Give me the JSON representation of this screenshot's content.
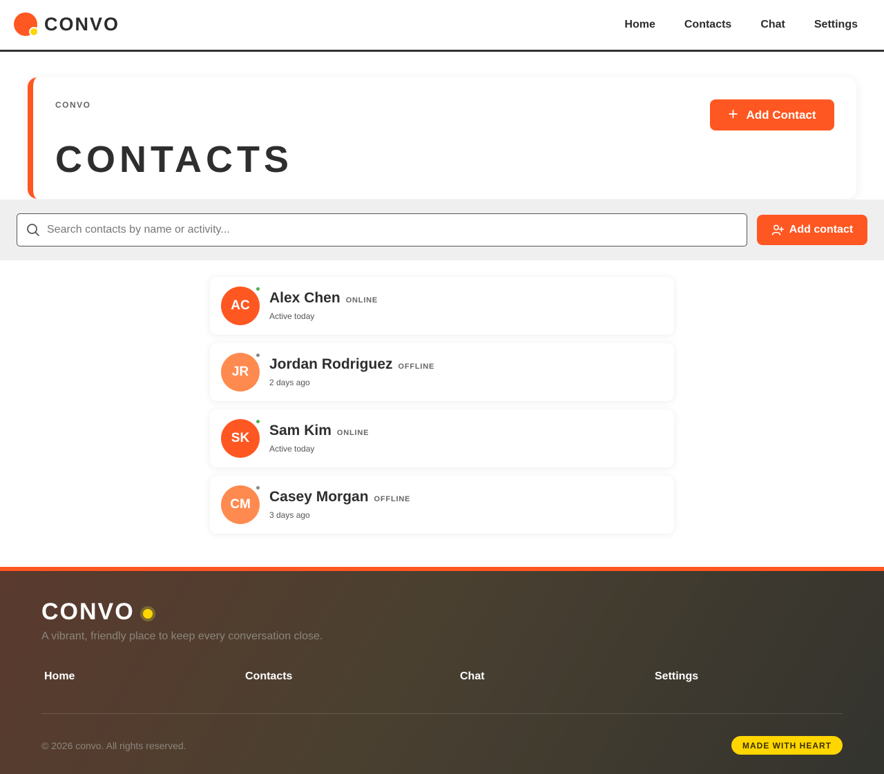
{
  "header": {
    "brand": "CONVO",
    "nav": [
      "Home",
      "Contacts",
      "Chat",
      "Settings"
    ]
  },
  "hero": {
    "eyebrow": "CONVO",
    "title": "CONTACTS",
    "add_button": "Add Contact"
  },
  "search": {
    "placeholder": "Search contacts by name or activity...",
    "value": "",
    "add_button": "Add contact"
  },
  "contacts": [
    {
      "initials": "AC",
      "name": "Alex Chen",
      "status": "ONLINE",
      "last_seen": "Active today",
      "avatar_color": "#ff5722",
      "presence_color": "#4caf50"
    },
    {
      "initials": "JR",
      "name": "Jordan Rodriguez",
      "status": "OFFLINE",
      "last_seen": "2 days ago",
      "avatar_color": "#ff8a50",
      "presence_color": "#888888"
    },
    {
      "initials": "SK",
      "name": "Sam Kim",
      "status": "ONLINE",
      "last_seen": "Active today",
      "avatar_color": "#ff5722",
      "presence_color": "#4caf50"
    },
    {
      "initials": "CM",
      "name": "Casey Morgan",
      "status": "OFFLINE",
      "last_seen": "3 days ago",
      "avatar_color": "#ff8a50",
      "presence_color": "#888888"
    }
  ],
  "footer": {
    "brand": "CONVO",
    "tagline": "A vibrant, friendly place to keep every conversation close.",
    "nav": [
      "Home",
      "Contacts",
      "Chat",
      "Settings"
    ],
    "copyright": "© 2026 convo. All rights reserved.",
    "badge": "MADE WITH HEART"
  },
  "colors": {
    "accent": "#ff5722",
    "accent_light": "#ff8a50",
    "highlight": "#ffd600",
    "online": "#4caf50",
    "offline": "#888888"
  }
}
